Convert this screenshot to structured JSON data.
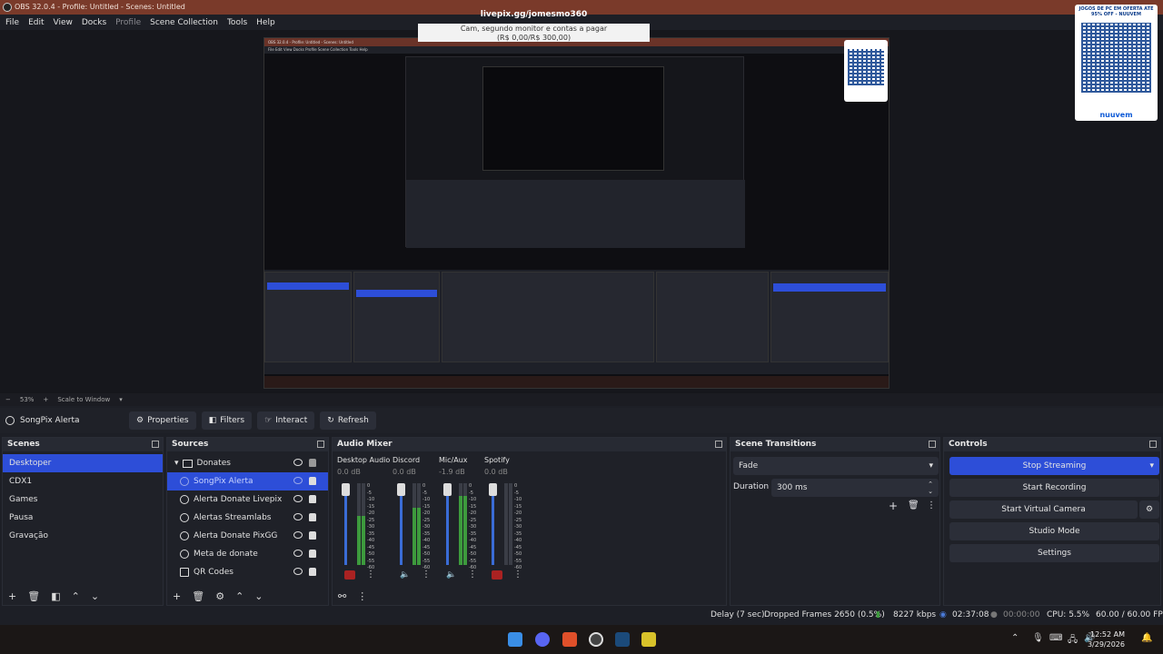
{
  "window": {
    "title": "OBS 32.0.4 - Profile: Untitled - Scenes: Untitled"
  },
  "menu": {
    "items": [
      "File",
      "Edit",
      "View",
      "Docks",
      "Profile",
      "Scene Collection",
      "Tools",
      "Help"
    ]
  },
  "preview": {
    "overlay_url": "livepix.gg/jomesmo360",
    "overlay_cam_line1": "Cam, segundo monitor e contas a pagar",
    "overlay_cam_line2": "(R$ 0,00/R$ 300,00)",
    "qr_small_title": "JOGOS DE PC EM OFERTA ATÉ 95% OFF - NUUVEM",
    "qr_brand": "nuuvem",
    "inner_title": "OBS 32.0.4 - Profile: Untitled - Scenes: Untitled",
    "inner_menu": "File  Edit  View  Docks  Profile  Scene Collection  Tools  Help"
  },
  "zoom": {
    "minus": "−",
    "value": "53%",
    "plus": "+",
    "mode": "Scale to Window"
  },
  "source_toolbar": {
    "source_name": "SongPix Alerta",
    "properties": "Properties",
    "filters": "Filters",
    "interact": "Interact",
    "refresh": "Refresh"
  },
  "scenes": {
    "title": "Scenes",
    "items": [
      "Desktoper",
      "CDX1",
      "Games",
      "Pausa",
      "Gravação"
    ],
    "selected": "Desktoper"
  },
  "sources": {
    "title": "Sources",
    "group": "Donates",
    "items": [
      "SongPix Alerta",
      "Alerta Donate Livepix",
      "Alertas Streamlabs",
      "Alerta Donate PixGG",
      "Meta de donate",
      "QR Codes"
    ],
    "selected": "SongPix Alerta"
  },
  "mixer": {
    "title": "Audio Mixer",
    "channels": [
      {
        "name": "Desktop Audio",
        "db": "0.0 dB",
        "level": 0.6,
        "muted": true
      },
      {
        "name": "Discord",
        "db": "0.0 dB",
        "level": 0.7,
        "muted": false
      },
      {
        "name": "Mic/Aux",
        "db": "-1.9 dB",
        "level": 0.85,
        "muted": false
      },
      {
        "name": "Spotify",
        "db": "0.0 dB",
        "level": 0.0,
        "muted": true
      }
    ],
    "scale": [
      "0",
      "-5",
      "-10",
      "-15",
      "-20",
      "-25",
      "-30",
      "-35",
      "-40",
      "-45",
      "-50",
      "-55",
      "-60"
    ]
  },
  "transitions": {
    "title": "Scene Transitions",
    "selected": "Fade",
    "duration_label": "Duration",
    "duration_value": "300 ms"
  },
  "controls": {
    "title": "Controls",
    "stop_streaming": "Stop Streaming",
    "start_recording": "Start Recording",
    "start_virtual_camera": "Start Virtual Camera",
    "studio_mode": "Studio Mode",
    "settings": "Settings"
  },
  "status": {
    "delay": "Delay (7 sec)",
    "dropped": "Dropped Frames 2650 (0.5%)",
    "bitrate": "8227 kbps",
    "stream_time": "02:37:08",
    "rec_time": "00:00:00",
    "cpu": "CPU: 5.5%",
    "fps": "60.00 / 60.00 FPS"
  },
  "taskbar": {
    "time": "12:52 AM",
    "date": "3/29/2026"
  },
  "colors": {
    "accent": "#2d4ed8",
    "titlebar": "#7a3a2a",
    "bg": "#1d1f26"
  }
}
